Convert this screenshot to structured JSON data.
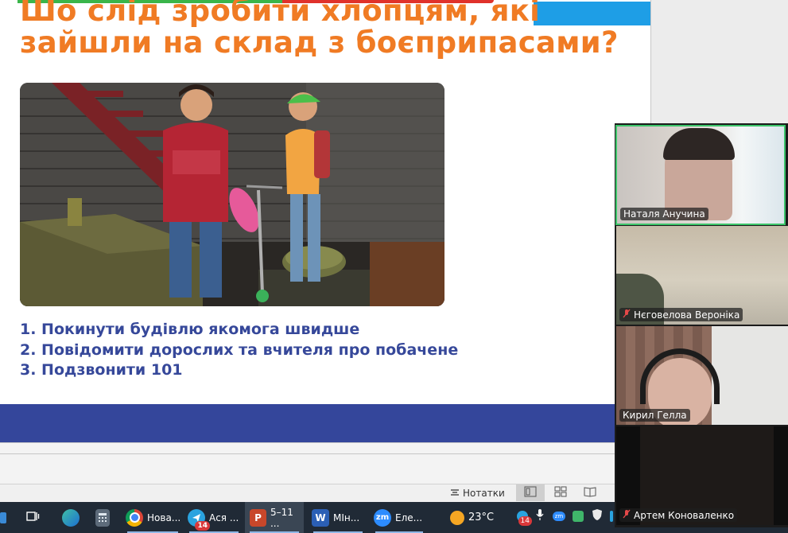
{
  "slide": {
    "title_line1": "Шо слід зробити хлопцям, які",
    "title_line2": "зайшли на склад з боєприпасами?",
    "answers": [
      "1. Покинути будівлю якомога швидше",
      "2. Повідомити дорослих та вчителя про побачене",
      "3. Подзвонити 101"
    ],
    "colors": {
      "title": "#f07b24",
      "answers": "#36489a",
      "footer_band": "#34469b",
      "top_blue": "#1e9ee6"
    }
  },
  "status_bar": {
    "notes_label": "Нотатки",
    "notes_icon": "notes-icon",
    "views": [
      "normal-view-icon",
      "slide-sorter-icon",
      "reading-view-icon"
    ]
  },
  "participants": [
    {
      "name": "Наталя Анучина",
      "muted": false
    },
    {
      "name": "Нєговелова Вероніка",
      "muted": true
    },
    {
      "name": "Кирил Гелла",
      "muted": false
    },
    {
      "name": "Артем Коноваленко",
      "muted": true
    }
  ],
  "taskbar": {
    "apps": [
      {
        "label": "Нова...",
        "icon": "chrome-icon"
      },
      {
        "label": "Ася ...",
        "icon": "telegram-icon",
        "badge": "14"
      },
      {
        "label": "5–11 ...",
        "icon": "powerpoint-icon"
      },
      {
        "label": "МІн...",
        "icon": "word-icon"
      },
      {
        "label": "Еле...",
        "icon": "zoom-icon"
      }
    ],
    "weather": "23°C",
    "tray_badge": "14"
  }
}
